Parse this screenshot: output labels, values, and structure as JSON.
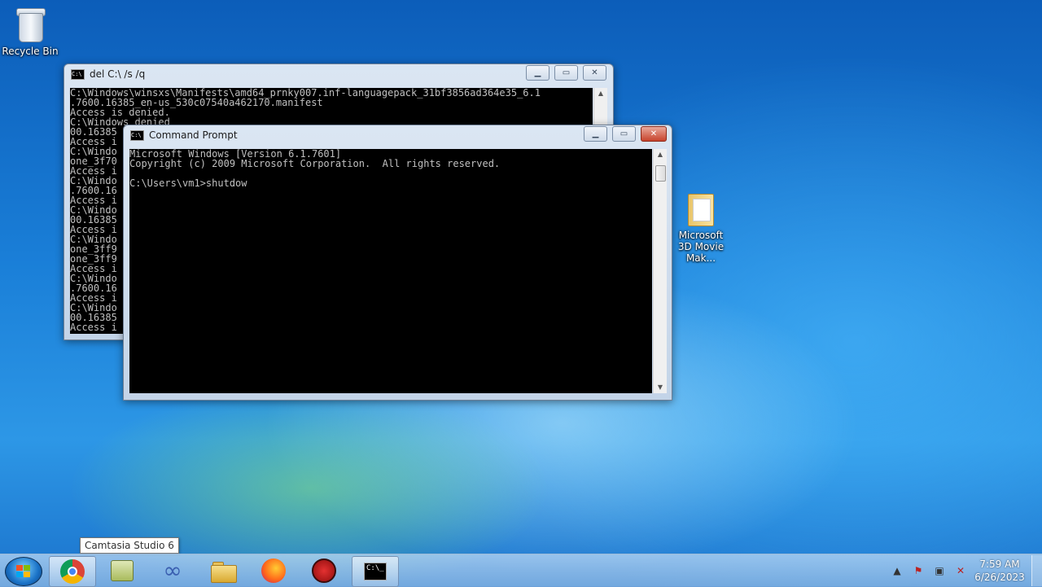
{
  "desktop": {
    "icons": [
      {
        "label": "Recycle Bin"
      },
      {
        "label": "Microsoft 3D Movie Mak..."
      }
    ]
  },
  "back_window": {
    "title": "del  C:\\ /s /q",
    "lines": [
      "C:\\Windows\\winsxs\\Manifests\\amd64_prnky007.inf-languagepack_31bf3856ad364e35_6.1",
      ".7600.16385_en-us_530c07540a462170.manifest",
      "Access is denied.",
      "C:\\Windows denied",
      "00.16385",
      "Access i",
      "C:\\Windo",
      "one_3f70",
      "Access i",
      "C:\\Windo",
      ".7600.16",
      "Access i",
      "C:\\Windo",
      "00.16385",
      "Access i",
      "C:\\Windo",
      "one_3ff9",
      "one_3ff9",
      "Access i",
      "C:\\Windo",
      ".7600.16",
      "Access i",
      "C:\\Windo",
      "00.16385",
      "Access i"
    ]
  },
  "front_window": {
    "title": "Command Prompt",
    "lines": [
      "Microsoft Windows [Version 6.1.7601]",
      "Copyright (c) 2009 Microsoft Corporation.  All rights reserved.",
      "",
      "C:\\Users\\vm1>shutdow"
    ]
  },
  "tooltip": "Camtasia Studio 6",
  "taskbar": {
    "buttons": [
      {
        "icon": "chrome-icon"
      },
      {
        "icon": "camtasia-icon"
      },
      {
        "icon": "infinity-icon"
      },
      {
        "icon": "explorer-icon"
      },
      {
        "icon": "firefox-icon"
      },
      {
        "icon": "red-app-icon"
      },
      {
        "icon": "cmd-icon"
      }
    ]
  },
  "clock": {
    "time": "7:59 AM",
    "date": "6/26/2023"
  }
}
